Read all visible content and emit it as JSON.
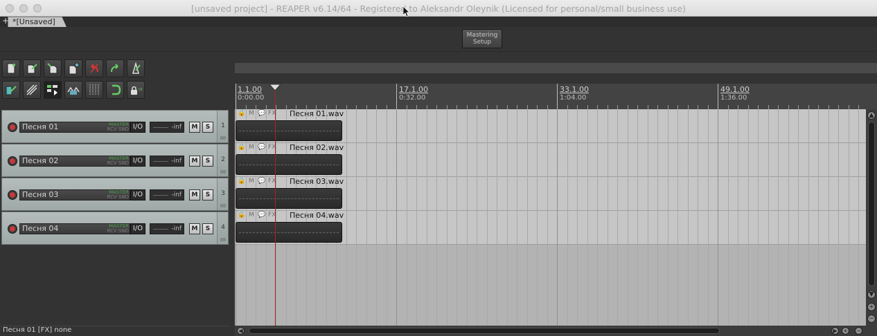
{
  "window": {
    "title": "[unsaved project] - REAPER v6.14/64 - Registered to Aleksandr Oleynik (Licensed for personal/small business use)"
  },
  "tabs": {
    "add_label": "+",
    "project_tab_label": "*[Unsaved]"
  },
  "master": {
    "button_line1": "Mastering",
    "button_line2": "Setup"
  },
  "ruler": {
    "markers": [
      {
        "bar": "1.1.00",
        "time": "0:00.00"
      },
      {
        "bar": "17.1.00",
        "time": "0:32.00"
      },
      {
        "bar": "33.1.00",
        "time": "1:04.00"
      },
      {
        "bar": "49.1.00",
        "time": "1:36.00"
      }
    ]
  },
  "tracks": [
    {
      "name": "Песня 01",
      "number": "1",
      "item": "Песня 01.wav",
      "volume": "-inf",
      "io": "I/O",
      "mute": "M",
      "solo": "S",
      "send_top": "MASTER",
      "send_bottom": "RCV SND"
    },
    {
      "name": "Песня 02",
      "number": "2",
      "item": "Песня 02.wav",
      "volume": "-inf",
      "io": "I/O",
      "mute": "M",
      "solo": "S",
      "send_top": "MASTER",
      "send_bottom": "RCV SND"
    },
    {
      "name": "Песня 03",
      "number": "3",
      "item": "Песня 03.wav",
      "volume": "-inf",
      "io": "I/O",
      "mute": "M",
      "solo": "S",
      "send_top": "MASTER",
      "send_bottom": "RCV SND"
    },
    {
      "name": "Песня 04",
      "number": "4",
      "item": "Песня 04.wav",
      "volume": "-inf",
      "io": "I/O",
      "mute": "M",
      "solo": "S",
      "send_top": "MASTER",
      "send_bottom": "RCV SND"
    }
  ],
  "item_header_icons": {
    "lock": "🔒",
    "mute": "M",
    "comment": "💬",
    "fx": "FX"
  },
  "toolbar": {
    "row1": [
      "new-project-icon",
      "open-project-icon",
      "save-project-icon",
      "project-settings-icon",
      "undo-icon",
      "redo-icon",
      "metronome-icon"
    ],
    "row2": [
      "snap-icon",
      "ripple-edit-icon",
      "grouping-icon",
      "envelope-points-icon",
      "grid-icon",
      "loop-icon",
      "auto-crossfade-icon"
    ],
    "row2_text_last": "ON"
  },
  "status": {
    "text": "Песня 01 [FX] none"
  },
  "colors": {
    "track_panel": "#a9b2b0",
    "playhead": "#b02020",
    "item_body": "#2f2f2f"
  }
}
